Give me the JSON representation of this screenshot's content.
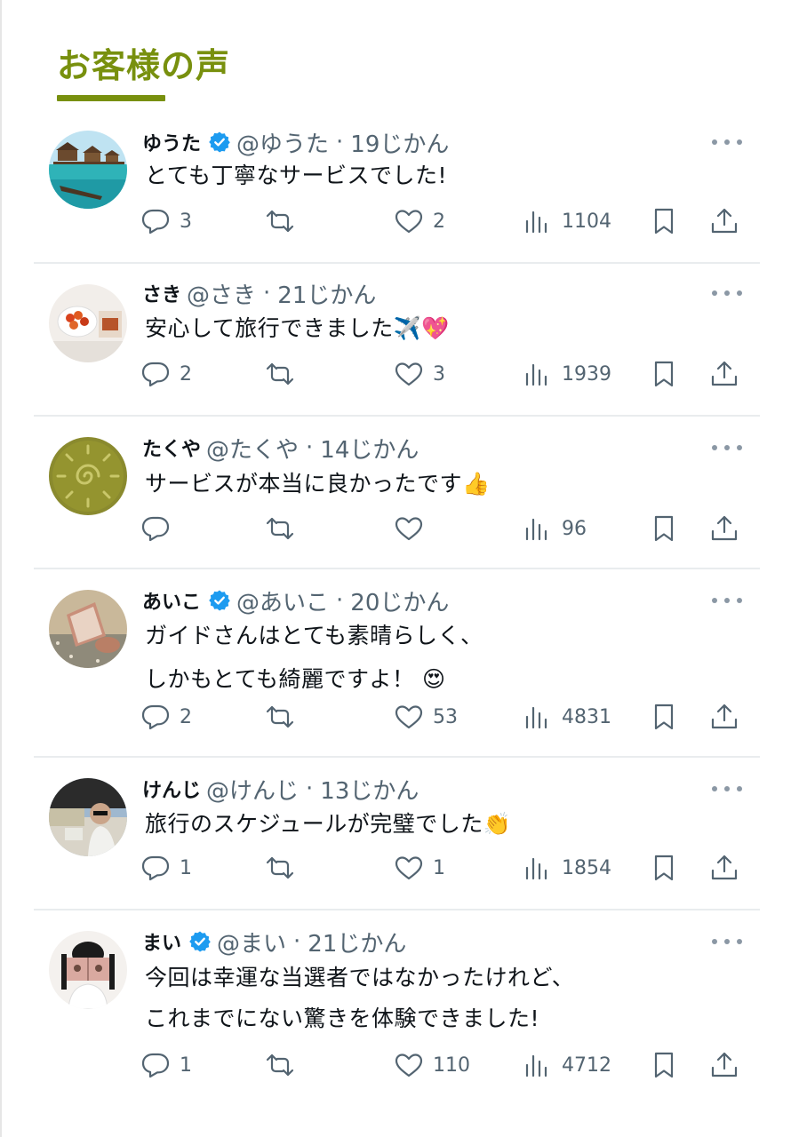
{
  "section": {
    "title": "お客様の声"
  },
  "colors": {
    "accent": "#78900e",
    "verified": "#1d9bf0",
    "muted": "#536471"
  },
  "icons": {
    "reply": "speech-bubble-icon",
    "retweet": "retweet-arrows-icon",
    "like": "heart-icon",
    "views": "bar-chart-icon",
    "bookmark": "bookmark-icon",
    "share": "share-upload-icon",
    "more": "more-dots-icon",
    "verified": "verified-badge-icon"
  },
  "tweets": [
    {
      "name": "ゆうた",
      "verified": true,
      "handle": "@ゆうた",
      "sep": "·",
      "time": "19じかん",
      "lines": [
        "とても丁寧なサービスでした!"
      ],
      "replies": "3",
      "retweets": "",
      "likes": "2",
      "views": "1104",
      "avatar": "overwater-bungalow-photo"
    },
    {
      "name": "さき",
      "verified": false,
      "handle": "@さき",
      "sep": "·",
      "time": "21じかん",
      "lines": [
        "安心して旅行できました✈️💖"
      ],
      "replies": "2",
      "retweets": "",
      "likes": "3",
      "views": "1939",
      "avatar": "food-plate-photo"
    },
    {
      "name": "たくや",
      "verified": false,
      "handle": "@たくや",
      "sep": "·",
      "time": "14じかん",
      "lines": [
        "サービスが本当に良かったです👍"
      ],
      "replies": "",
      "retweets": "",
      "likes": "",
      "views": "96",
      "avatar": "sun-emblem-photo"
    },
    {
      "name": "あいこ",
      "verified": true,
      "handle": "@あいこ",
      "sep": "·",
      "time": "20じかん",
      "lines": [
        "ガイドさんはとても素晴らしく、",
        "しかもとても綺麗ですよ！ 😍"
      ],
      "replies": "2",
      "retweets": "",
      "likes": "53",
      "views": "4831",
      "avatar": "book-by-water-photo"
    },
    {
      "name": "けんじ",
      "verified": false,
      "handle": "@けんじ",
      "sep": "·",
      "time": "13じかん",
      "lines": [
        "旅行のスケジュールが完璧でした👏"
      ],
      "replies": "1",
      "retweets": "",
      "likes": "1",
      "views": "1854",
      "avatar": "person-in-car-photo"
    },
    {
      "name": "まい",
      "verified": true,
      "handle": "@まい",
      "sep": "·",
      "time": "21じかん",
      "lines": [
        "今回は幸運な当選者ではなかったけれど、",
        "これまでにない驚きを体験できました!"
      ],
      "replies": "1",
      "retweets": "",
      "likes": "110",
      "views": "4712",
      "avatar": "person-with-book-photo"
    }
  ]
}
